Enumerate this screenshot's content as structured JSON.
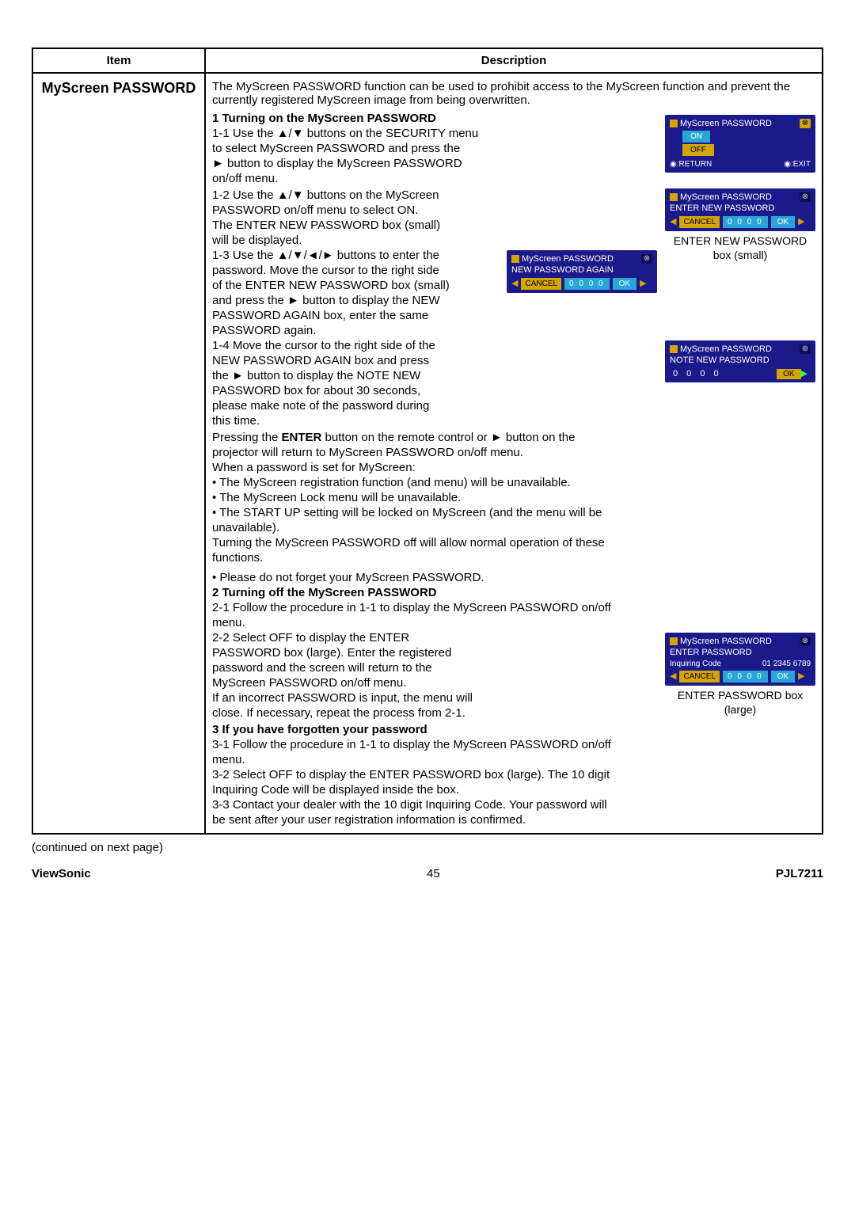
{
  "table": {
    "header_item": "Item",
    "header_desc": "Description",
    "item_name": "MyScreen PASSWORD",
    "intro": "The MyScreen PASSWORD function can be used to prohibit access to the MyScreen function and prevent the currently registered MyScreen image from being overwritten.",
    "h1": "1 Turning on the MyScreen PASSWORD",
    "s1_1a": "1-1 Use the ▲/▼ buttons on the SECURITY menu",
    "s1_1b": "to select MyScreen PASSWORD and press the",
    "s1_1c": "► button to display the MyScreen PASSWORD",
    "s1_1d": "on/off menu.",
    "s1_2a": "1-2 Use the ▲/▼ buttons on the MyScreen",
    "s1_2b": "PASSWORD on/off menu to select ON.",
    "s1_2c": "The ENTER NEW PASSWORD box (small)",
    "s1_2d": "will be displayed.",
    "s1_3a": "1-3 Use the ▲/▼/◄/► buttons to enter the",
    "s1_3b": "password. Move the cursor to the right side",
    "s1_3c": "of the ENTER NEW PASSWORD box (small)",
    "s1_3d": "and press the ► button to display the NEW",
    "s1_3e": "PASSWORD AGAIN box, enter the same",
    "s1_3f": "PASSWORD again.",
    "s1_4a": "1-4 Move the cursor to the right side of the",
    "s1_4b": "NEW PASSWORD AGAIN box and press",
    "s1_4c": "the ► button to display the NOTE NEW",
    "s1_4d": "PASSWORD box for about 30 seconds,",
    "s1_4e": "please make note of the password during",
    "s1_4f": "this time.",
    "s1_press_a": "Pressing the ",
    "s1_press_enter": "ENTER",
    "s1_press_b": " button on the remote control or ► button on the",
    "s1_press_c": "projector will return to MyScreen PASSWORD on/off menu.",
    "when_set": "When a password is set for MyScreen:",
    "b1": "• The MyScreen registration function (and menu) will be unavailable.",
    "b2": "• The MyScreen Lock menu will be unavailable.",
    "b3a": "• The START UP setting will be locked on MyScreen (and the menu will be",
    "b3b": "unavailable).",
    "turn_off_note1": "Turning the MyScreen PASSWORD off will allow normal operation of these",
    "turn_off_note2": "functions.",
    "dont_forget": "• Please do not forget your MyScreen PASSWORD.",
    "h2": "2 Turning off the MyScreen PASSWORD",
    "s2_1a": "2-1 Follow the procedure in 1-1 to display the MyScreen PASSWORD on/off",
    "s2_1b": "menu.",
    "s2_2a": "2-2 Select OFF to display the ENTER",
    "s2_2b": "PASSWORD box (large). Enter the registered",
    "s2_2c": "password and the screen will return to the",
    "s2_2d": "MyScreen PASSWORD on/off menu.",
    "s2_incorrect1": "If an incorrect PASSWORD is input, the menu will",
    "s2_incorrect2": "close. If necessary, repeat the process from 2-1.",
    "h3": "3 If you have forgotten your password",
    "s3_1a": "3-1 Follow the procedure in 1-1 to display the MyScreen PASSWORD on/off",
    "s3_1b": "menu.",
    "s3_2a": "3-2 Select OFF to display the ENTER PASSWORD box (large). The 10 digit",
    "s3_2b": "Inquiring Code will be displayed inside the box.",
    "s3_3a": "3-3 Contact your dealer with the 10 digit Inquiring Code. Your password will",
    "s3_3b": "be sent after your user registration information is confirmed.",
    "ui": {
      "title": "MyScreen PASSWORD",
      "on": "ON",
      "off": "OFF",
      "return": "◉:RETURN",
      "exit": "◉:EXIT",
      "enter_new": "ENTER NEW PASSWORD",
      "cancel": "CANCEL",
      "digits": "0 0 0 0",
      "ok": "OK",
      "caption_small1": "ENTER NEW PASSWORD",
      "caption_small2": "box (small)",
      "new_again": "NEW PASSWORD AGAIN",
      "note_new": "NOTE NEW PASSWORD",
      "enter_pw": "ENTER PASSWORD",
      "inquiring": "Inquiring Code",
      "inq_code": "01 2345 6789",
      "caption_large1": "ENTER PASSWORD box",
      "caption_large2": "(large)"
    }
  },
  "continued": "(continued on next page)",
  "footer": {
    "left": "ViewSonic",
    "center": "45",
    "right": "PJL7211"
  }
}
